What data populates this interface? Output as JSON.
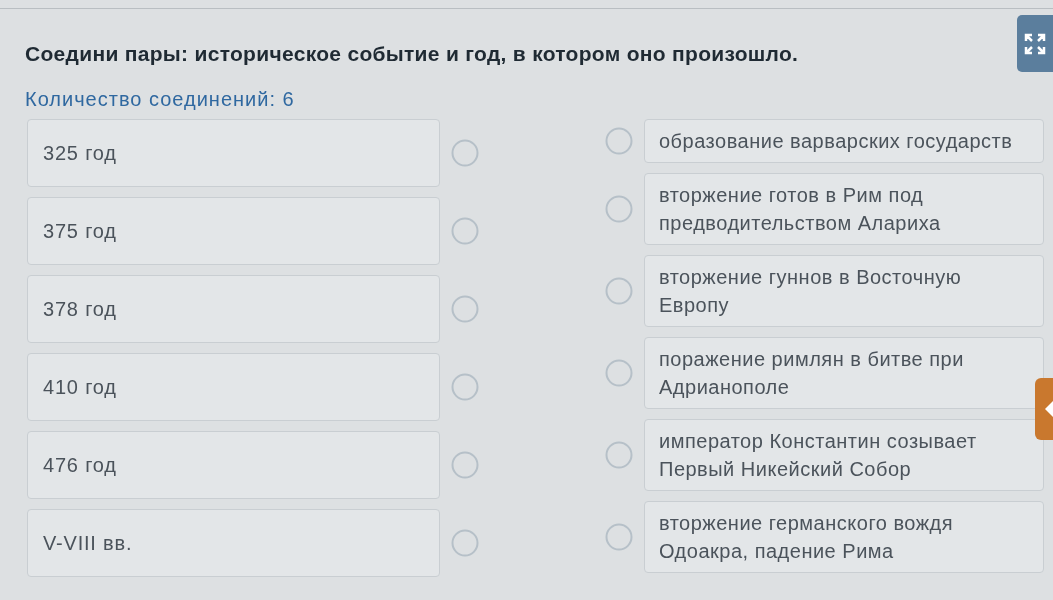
{
  "question": {
    "title": "Соедини пары: историческое событие и год, в котором оно произошло.",
    "connection_count": "Количество соединений: 6"
  },
  "left_items": [
    {
      "text": "325 год"
    },
    {
      "text": "375 год"
    },
    {
      "text": "378 год"
    },
    {
      "text": "410 год"
    },
    {
      "text": "476 год"
    },
    {
      "text": "V-VIII вв."
    }
  ],
  "right_items": [
    {
      "text": "образование варварских государств"
    },
    {
      "text": "вторжение готов в Рим под предводительством Алариха"
    },
    {
      "text": "вторжение гуннов в Восточную Европу"
    },
    {
      "text": "поражение римлян в битве при Адрианополе"
    },
    {
      "text": "император Константин созывает Первый Никейский Собор"
    },
    {
      "text": "вторжение германского вождя Одоакра, падение Рима"
    }
  ]
}
